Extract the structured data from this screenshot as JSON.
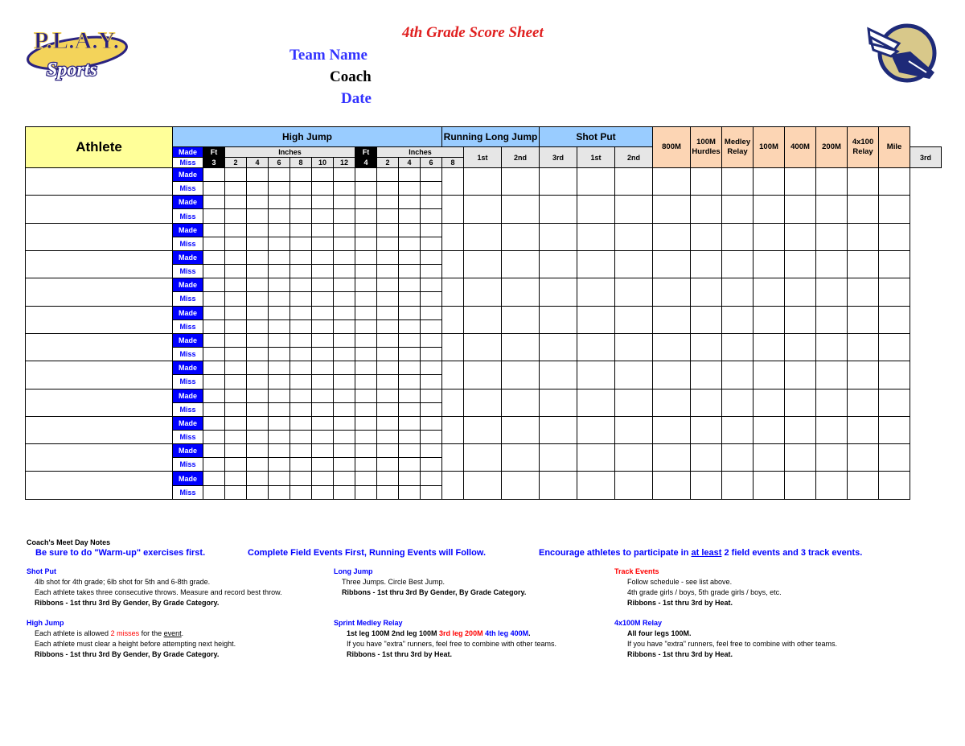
{
  "header": {
    "title": "4th Grade Score Sheet",
    "team_name_label": "Team Name",
    "coach_label": "Coach",
    "date_label": "Date",
    "left_logo_text": "P.L.A.Y. Sports",
    "colors": {
      "title": "#e02020",
      "team": "#3333ff",
      "date": "#3333ff"
    }
  },
  "table": {
    "athlete_header": "Athlete",
    "high_jump": {
      "label": "High Jump",
      "made": "Made",
      "miss": "Miss",
      "ft": "Ft",
      "inches": "Inches",
      "heights_group1": {
        "ft": "3",
        "inches": [
          "2",
          "4",
          "6",
          "8",
          "10",
          "12"
        ]
      },
      "heights_group2": {
        "ft": "4",
        "inches": [
          "2",
          "4",
          "6",
          "8"
        ]
      }
    },
    "running_long_jump": {
      "label": "Running Long Jump",
      "attempts": [
        "1st",
        "2nd",
        "3rd"
      ]
    },
    "shot_put": {
      "label": "Shot Put",
      "attempts": [
        "1st",
        "2nd",
        "3rd"
      ]
    },
    "track_events": [
      "800M",
      "100M Hurdles",
      "Medley Relay",
      "100M",
      "400M",
      "200M",
      "4x100 Relay",
      "Mile"
    ],
    "row_labels": {
      "made": "Made",
      "miss": "Miss"
    },
    "athlete_rows": 12,
    "colors": {
      "athlete": "#ffff99",
      "field": "#99ccff",
      "track": "#fcd5b4",
      "made": "#0000ff"
    }
  },
  "notes": {
    "heading": "Coach's Meet Day Notes",
    "banner1": "Be sure to do \"Warm-up\" exercises first.",
    "banner2": "Complete Field Events First, Running Events will Follow.",
    "banner3_pre": "Encourage athletes to participate in ",
    "banner3_u": "at least",
    "banner3_post": " 2 field events and 3 track events.",
    "shot_put": {
      "title": "Shot Put",
      "l1": "4lb shot for 4th grade; 6lb shot for 5th and 6-8th grade.",
      "l2": "Each athlete takes three consecutive throws.  Measure and record best throw.",
      "l3": "Ribbons - 1st thru 3rd By Gender, By Grade Category."
    },
    "high_jump": {
      "title": "High Jump",
      "l1_pre": "Each athlete is allowed ",
      "l1_red": "2 misses",
      "l1_mid": " for the ",
      "l1_u": "event",
      "l1_post": ".",
      "l2": "Each athlete must clear a height before attempting next height.",
      "l3": "Ribbons - 1st thru 3rd By Gender, By Grade Category."
    },
    "long_jump": {
      "title": "Long Jump",
      "l1": "Three Jumps. Circle Best Jump.",
      "l2": "Ribbons - 1st thru 3rd By Gender, By Grade Category."
    },
    "sprint_medley": {
      "title": "Sprint Medley Relay",
      "l1_a": "1st leg 100M 2nd leg 100M ",
      "l1_b": "3rd leg 200M ",
      "l1_c": "4th leg 400M",
      "l1_d": ".",
      "l2": "If you have \"extra\" runners, feel free to combine with other teams.",
      "l3": "Ribbons - 1st thru 3rd by Heat."
    },
    "track_events": {
      "title": "Track Events",
      "l1": "Follow schedule - see list above.",
      "l2": "4th grade girls / boys, 5th grade girls / boys, etc.",
      "l3": "Ribbons - 1st thru 3rd by Heat."
    },
    "relay_4x100": {
      "title": "4x100M Relay",
      "l1": "All four legs 100M.",
      "l2": "If you have \"extra\" runners, feel free to combine with other teams.",
      "l3": "Ribbons - 1st thru 3rd by Heat."
    }
  }
}
